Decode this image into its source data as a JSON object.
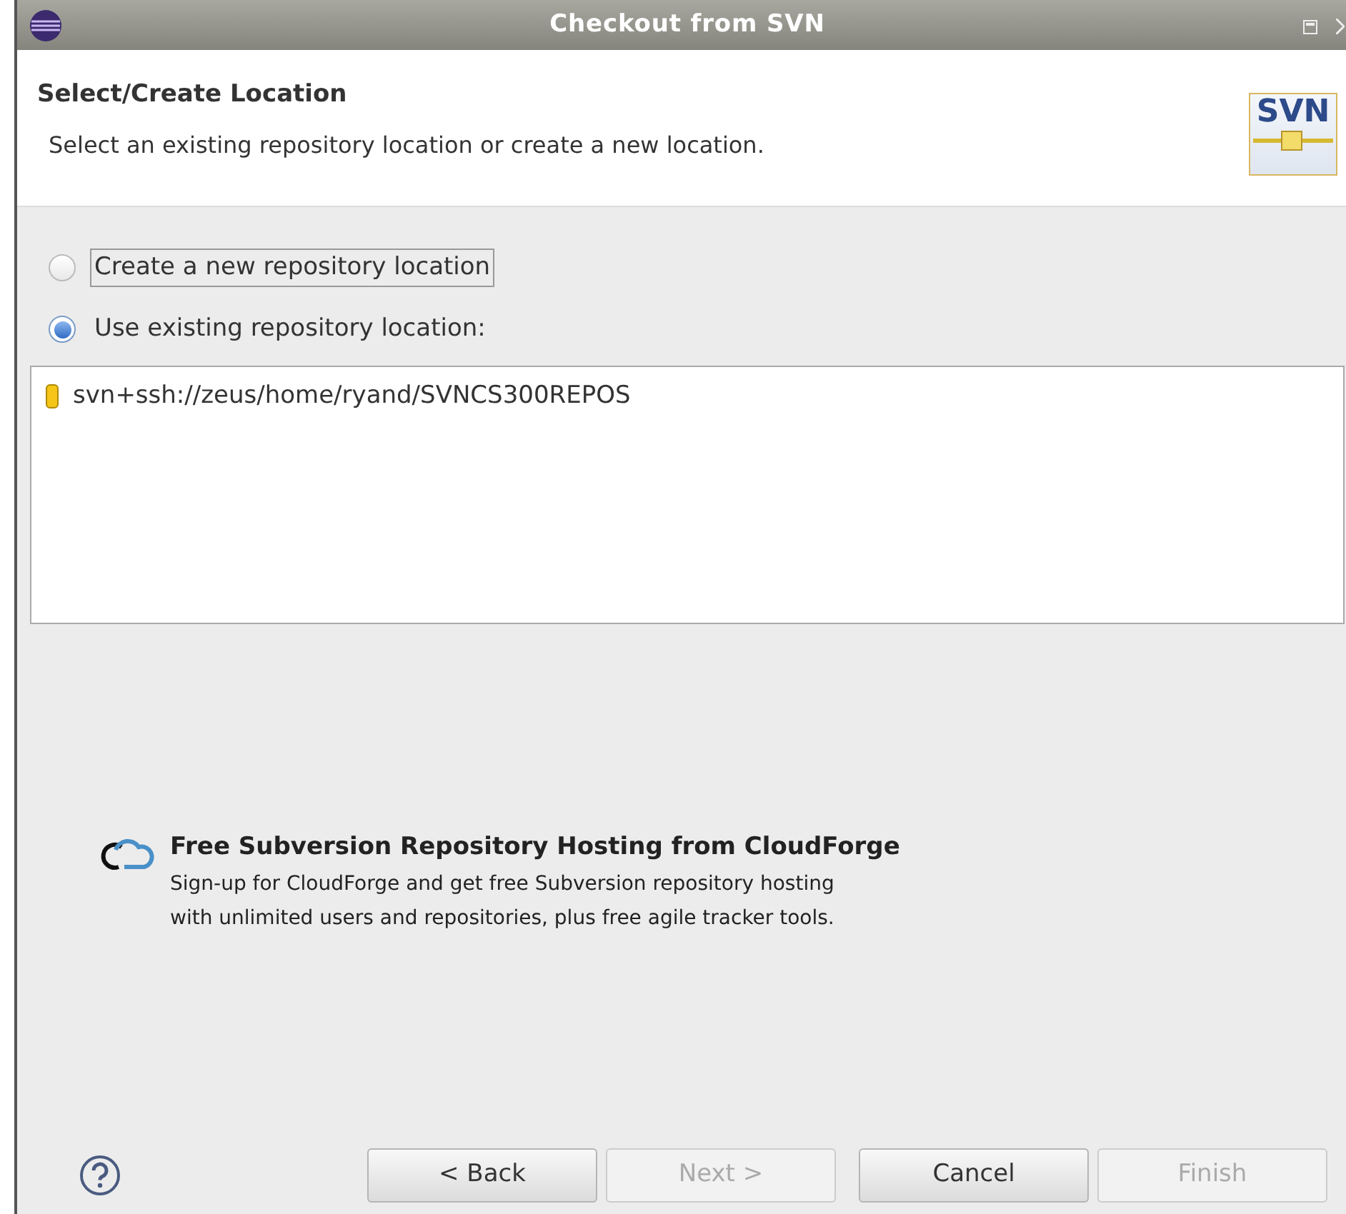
{
  "window": {
    "title": "Checkout from SVN"
  },
  "header": {
    "title": "Select/Create Location",
    "description": "Select an existing repository location or create a new location.",
    "logo_text": "SVN"
  },
  "options": [
    {
      "label": "Create a new repository location",
      "selected": false,
      "focused": true
    },
    {
      "label": "Use existing repository location:",
      "selected": true,
      "focused": false
    }
  ],
  "locations": [
    {
      "url": "svn+ssh://zeus/home/ryand/SVNCS300REPOS"
    }
  ],
  "promo": {
    "title": "Free Subversion Repository Hosting from CloudForge",
    "text": "Sign-up for CloudForge and get free Subversion repository hosting\nwith unlimited users and repositories, plus free agile tracker tools."
  },
  "buttons": [
    {
      "label": "< Back",
      "disabled": false
    },
    {
      "label": "Next >",
      "disabled": true
    },
    {
      "label": "Cancel",
      "disabled": false
    },
    {
      "label": "Finish",
      "disabled": true
    }
  ]
}
